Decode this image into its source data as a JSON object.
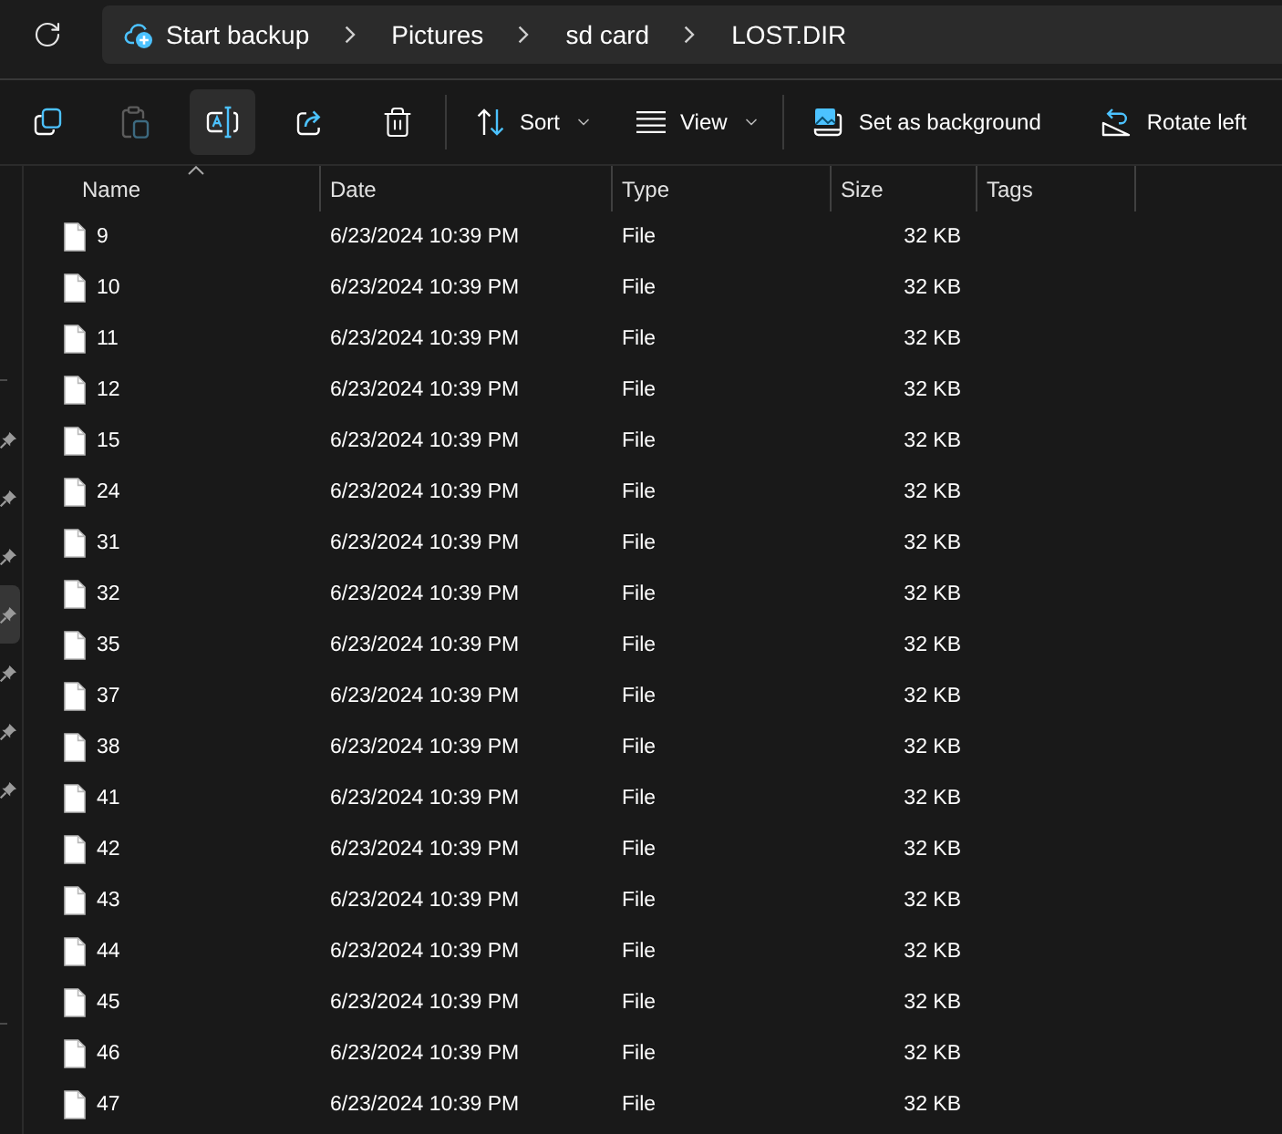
{
  "address_bar": {
    "breadcrumbs": [
      "Start backup",
      "Pictures",
      "sd card",
      "LOST.DIR"
    ]
  },
  "toolbar": {
    "icon_buttons": [
      {
        "disabled": false,
        "hovered": false
      },
      {
        "disabled": true,
        "hovered": false
      },
      {
        "disabled": false,
        "hovered": true
      },
      {
        "disabled": false,
        "hovered": false
      },
      {
        "disabled": false,
        "hovered": false
      }
    ],
    "menu_buttons": [
      {
        "label": "Sort",
        "dropdown": true
      },
      {
        "label": "View",
        "dropdown": true
      }
    ],
    "actions": [
      {
        "label": "Set as background"
      },
      {
        "label": "Rotate left"
      }
    ]
  },
  "navigation_pane": {
    "items": [
      {
        "pinned": true,
        "hovered": false
      },
      {
        "pinned": true,
        "hovered": false
      },
      {
        "pinned": true,
        "hovered": false
      },
      {
        "pinned": true,
        "hovered": true
      },
      {
        "pinned": true,
        "hovered": false
      },
      {
        "pinned": true,
        "hovered": false
      },
      {
        "pinned": true,
        "hovered": false
      }
    ]
  },
  "file_list": {
    "columns": [
      {
        "label": "Name",
        "sorted": true
      },
      {
        "label": "Date",
        "sorted": false
      },
      {
        "label": "Type",
        "sorted": false
      },
      {
        "label": "Size",
        "sorted": false
      },
      {
        "label": "Tags",
        "sorted": false
      }
    ],
    "rows": [
      {
        "name": "9",
        "date": "6/23/2024 10:39 PM",
        "type": "File",
        "size": "32 KB"
      },
      {
        "name": "10",
        "date": "6/23/2024 10:39 PM",
        "type": "File",
        "size": "32 KB"
      },
      {
        "name": "11",
        "date": "6/23/2024 10:39 PM",
        "type": "File",
        "size": "32 KB"
      },
      {
        "name": "12",
        "date": "6/23/2024 10:39 PM",
        "type": "File",
        "size": "32 KB"
      },
      {
        "name": "15",
        "date": "6/23/2024 10:39 PM",
        "type": "File",
        "size": "32 KB"
      },
      {
        "name": "24",
        "date": "6/23/2024 10:39 PM",
        "type": "File",
        "size": "32 KB"
      },
      {
        "name": "31",
        "date": "6/23/2024 10:39 PM",
        "type": "File",
        "size": "32 KB"
      },
      {
        "name": "32",
        "date": "6/23/2024 10:39 PM",
        "type": "File",
        "size": "32 KB"
      },
      {
        "name": "35",
        "date": "6/23/2024 10:39 PM",
        "type": "File",
        "size": "32 KB"
      },
      {
        "name": "37",
        "date": "6/23/2024 10:39 PM",
        "type": "File",
        "size": "32 KB"
      },
      {
        "name": "38",
        "date": "6/23/2024 10:39 PM",
        "type": "File",
        "size": "32 KB"
      },
      {
        "name": "41",
        "date": "6/23/2024 10:39 PM",
        "type": "File",
        "size": "32 KB"
      },
      {
        "name": "42",
        "date": "6/23/2024 10:39 PM",
        "type": "File",
        "size": "32 KB"
      },
      {
        "name": "43",
        "date": "6/23/2024 10:39 PM",
        "type": "File",
        "size": "32 KB"
      },
      {
        "name": "44",
        "date": "6/23/2024 10:39 PM",
        "type": "File",
        "size": "32 KB"
      },
      {
        "name": "45",
        "date": "6/23/2024 10:39 PM",
        "type": "File",
        "size": "32 KB"
      },
      {
        "name": "46",
        "date": "6/23/2024 10:39 PM",
        "type": "File",
        "size": "32 KB"
      },
      {
        "name": "47",
        "date": "6/23/2024 10:39 PM",
        "type": "File",
        "size": "32 KB"
      }
    ]
  }
}
